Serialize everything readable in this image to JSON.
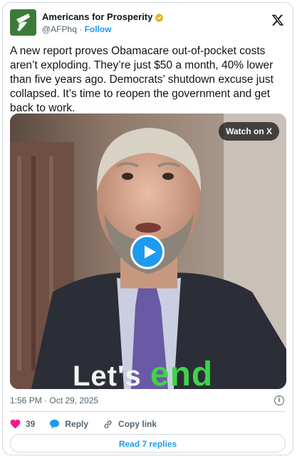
{
  "author": {
    "name": "Americans for Prosperity",
    "handle": "@AFPhq",
    "separator": "·",
    "follow_label": "Follow"
  },
  "tweet": {
    "text": "A new report proves Obamacare out-of-pocket costs aren’t exploding. They’re just $50 a month, 40% lower than five years ago. Democrats’ shutdown excuse just collapsed. It’s time to reopen the government and get back to work."
  },
  "media": {
    "watch_label": "Watch on X",
    "caption_white": "Let's ",
    "caption_green": "end"
  },
  "meta": {
    "timestamp": "1:56 PM · Oct 29, 2025",
    "info_glyph": "i"
  },
  "actions": {
    "like_count": "39",
    "reply_label": "Reply",
    "copy_link_label": "Copy link"
  },
  "footer": {
    "read_replies_label": "Read 7 replies"
  },
  "colors": {
    "accent": "#1d9bf0",
    "like": "#f91880",
    "avatar_bg": "#3c7a3a",
    "caption_green": "#3fd34a"
  },
  "icons": [
    "verified-badge-icon",
    "x-logo-icon",
    "play-icon",
    "info-icon",
    "heart-icon",
    "reply-bubble-icon",
    "link-icon"
  ]
}
